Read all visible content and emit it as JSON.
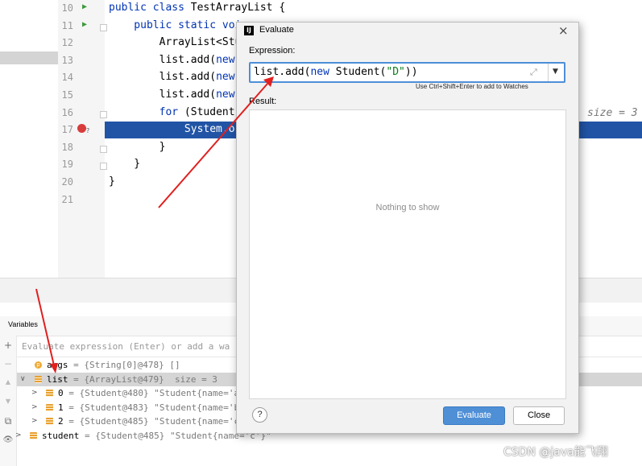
{
  "editor": {
    "lines": [
      {
        "num": "10",
        "parts": [
          {
            "t": "public class ",
            "c": "kw"
          },
          {
            "t": "TestArrayList {",
            "c": ""
          }
        ]
      },
      {
        "num": "11",
        "parts": [
          {
            "t": "    public static voi",
            "c": "kw"
          }
        ]
      },
      {
        "num": "12",
        "parts": [
          {
            "t": "        ArrayList<Stu",
            "c": ""
          }
        ]
      },
      {
        "num": "13",
        "parts": [
          {
            "t": "        list.add(",
            "c": ""
          },
          {
            "t": "new",
            "c": "kw"
          }
        ]
      },
      {
        "num": "14",
        "parts": [
          {
            "t": "        list.add(",
            "c": ""
          },
          {
            "t": "new",
            "c": "kw"
          }
        ]
      },
      {
        "num": "15",
        "parts": [
          {
            "t": "        list.add(",
            "c": ""
          },
          {
            "t": "new",
            "c": "kw"
          }
        ]
      },
      {
        "num": "16",
        "parts": [
          {
            "t": "        ",
            "c": ""
          },
          {
            "t": "for",
            "c": "kw"
          },
          {
            "t": " (Student",
            "c": ""
          }
        ]
      },
      {
        "num": "17",
        "parts": [
          {
            "t": "            System.",
            "c": "hl"
          },
          {
            "t": "o",
            "c": "hl"
          }
        ]
      },
      {
        "num": "18",
        "parts": [
          {
            "t": "        }",
            "c": ""
          }
        ]
      },
      {
        "num": "19",
        "parts": [
          {
            "t": "    }",
            "c": ""
          }
        ]
      },
      {
        "num": "20",
        "parts": [
          {
            "t": "}",
            "c": ""
          }
        ]
      },
      {
        "num": "21",
        "parts": []
      }
    ],
    "inline_hint": "size = 3"
  },
  "variables": {
    "title": "Variables",
    "eval_placeholder": "Evaluate expression (Enter) or add a wa",
    "rows": [
      {
        "arrow": "",
        "icon": "p",
        "name": "args",
        "value": " = {String[0]@478} []"
      },
      {
        "arrow": "∨",
        "icon": "list",
        "name": "list",
        "value": " = {ArrayList@479}  size = 3"
      },
      {
        "arrow": ">",
        "icon": "list",
        "name": "0",
        "value": " = {Student@480} \"Student{name='a'"
      },
      {
        "arrow": ">",
        "icon": "list",
        "name": "1",
        "value": " = {Student@483} \"Student{name='b'"
      },
      {
        "arrow": ">",
        "icon": "list",
        "name": "2",
        "value": " = {Student@485} \"Student{name='c'"
      },
      {
        "arrow": ">",
        "icon": "list",
        "name": "student",
        "value": " = {Student@485} \"Student{name='c'}\""
      }
    ],
    "toolbar": [
      "+",
      "−",
      "▲",
      "▼",
      "⧉",
      "👁"
    ]
  },
  "dialog": {
    "title": "Evaluate",
    "close_glyph": "×",
    "expression_label": "Expression:",
    "expression_value": "list.add(new Student(\"D\"))",
    "expand_glyph": "⤢",
    "history_glyph": "▼",
    "hint": "Use Ctrl+Shift+Enter to add to Watches",
    "result_label": "Result:",
    "empty_text": "Nothing to show",
    "help_label": "?",
    "evaluate_label": "Evaluate",
    "close_label": "Close"
  },
  "watermark": "CSDN @java能飞翔",
  "colors": {
    "accent": "#4f8fd6",
    "highlight_row": "#2154a5",
    "annotation_arrow": "#e0201f"
  }
}
